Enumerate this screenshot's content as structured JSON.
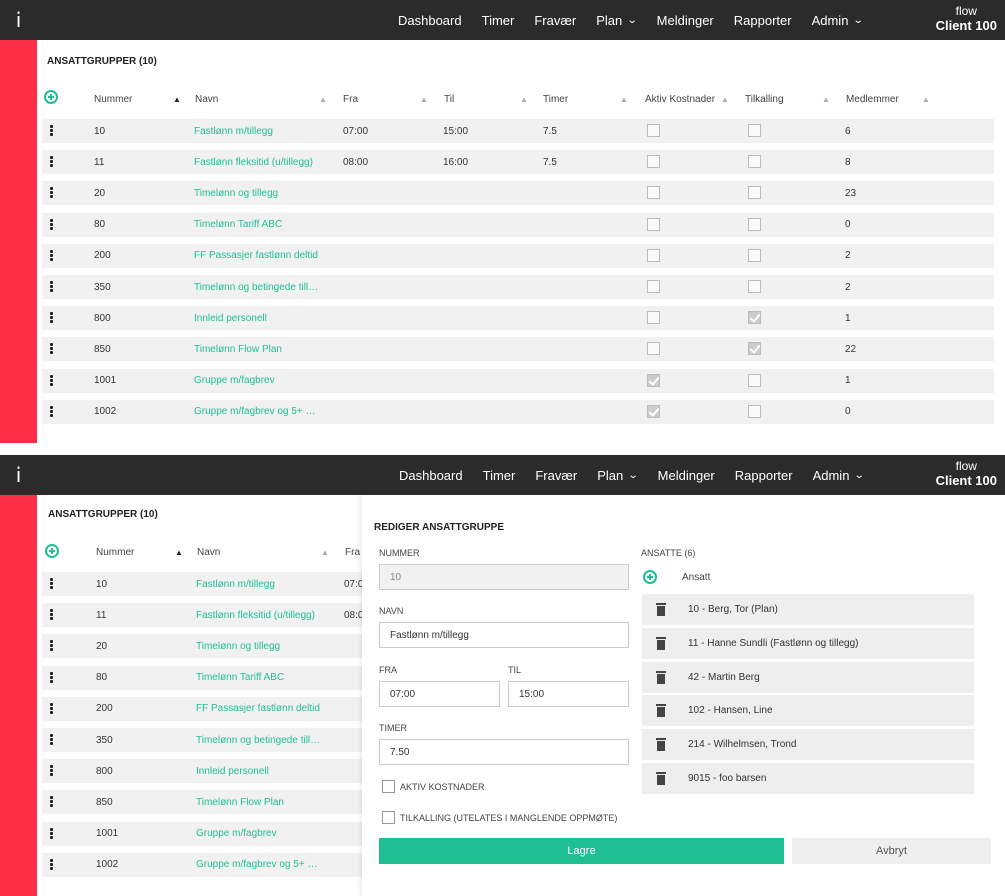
{
  "topbar": {
    "logo": "i",
    "nav": [
      "Dashboard",
      "Timer",
      "Fravær",
      "Plan",
      "Meldinger",
      "Rapporter",
      "Admin"
    ],
    "client_line1": "flow",
    "client_line2": "Client 100"
  },
  "list": {
    "title": "ANSATTGRUPPER (10)",
    "headers": {
      "nummer": "Nummer",
      "navn": "Navn",
      "fra": "Fra",
      "til": "Til",
      "timer": "Timer",
      "aktiv": "Aktiv Kostnader",
      "tilkalling": "Tilkalling",
      "medlemmer": "Medlemmer"
    },
    "rows": [
      {
        "nummer": "10",
        "navn": "Fastlønn m/tillegg",
        "navn_short": "Fastlønn m/tillegg",
        "fra": "07:00",
        "til": "15:00",
        "timer": "7.5",
        "aktiv": false,
        "tilkalling": false,
        "medlemmer": "6"
      },
      {
        "nummer": "11",
        "navn": "Fastlønn fleksitid (u/tillegg)",
        "navn_short": "Fastlønn fleksitid (u/tillegg)",
        "fra": "08:00",
        "til": "16:00",
        "timer": "7.5",
        "aktiv": false,
        "tilkalling": false,
        "medlemmer": "8"
      },
      {
        "nummer": "20",
        "navn": "Timelønn og tillegg",
        "navn_short": "Timelønn og tillegg",
        "fra": "",
        "til": "",
        "timer": "",
        "aktiv": false,
        "tilkalling": false,
        "medlemmer": "23"
      },
      {
        "nummer": "80",
        "navn": "Timelønn Tariff ABC",
        "navn_short": "Timelønn Tariff ABC",
        "fra": "",
        "til": "",
        "timer": "",
        "aktiv": false,
        "tilkalling": false,
        "medlemmer": "0"
      },
      {
        "nummer": "200",
        "navn": "FF Passasjer fastlønn deltid",
        "navn_short": "FF Passasjer fastlønn deltid",
        "fra": "",
        "til": "",
        "timer": "",
        "aktiv": false,
        "tilkalling": false,
        "medlemmer": "2"
      },
      {
        "nummer": "350",
        "navn": "Timelønn og betingede till…",
        "navn_short": "Timelønn og betingede till…",
        "fra": "",
        "til": "",
        "timer": "",
        "aktiv": false,
        "tilkalling": false,
        "medlemmer": "2"
      },
      {
        "nummer": "800",
        "navn": "Innleid personell",
        "navn_short": "Innleid personell",
        "fra": "",
        "til": "",
        "timer": "",
        "aktiv": false,
        "tilkalling": true,
        "medlemmer": "1"
      },
      {
        "nummer": "850",
        "navn": "Timelønn Flow Plan",
        "navn_short": "Timelønn Flow Plan",
        "fra": "",
        "til": "",
        "timer": "",
        "aktiv": false,
        "tilkalling": true,
        "medlemmer": "22"
      },
      {
        "nummer": "1001",
        "navn": "Gruppe m/fagbrev",
        "navn_short": "Gruppe m/fagbrev",
        "fra": "",
        "til": "",
        "timer": "",
        "aktiv": true,
        "tilkalling": false,
        "medlemmer": "1"
      },
      {
        "nummer": "1002",
        "navn": "Gruppe m/fagbrev og 5+ …",
        "navn_short": "Gruppe m/fagbrev og 5+ …",
        "fra": "",
        "til": "",
        "timer": "",
        "aktiv": true,
        "tilkalling": false,
        "medlemmer": "0"
      }
    ],
    "panel2_fra": [
      "07:0",
      "08:0"
    ]
  },
  "edit": {
    "title": "REDIGER ANSATTGRUPPE",
    "nummer_label": "NUMMER",
    "nummer_value": "10",
    "navn_label": "NAVN",
    "navn_value": "Fastlønn m/tillegg",
    "fra_label": "FRA",
    "fra_value": "07:00",
    "til_label": "TIL",
    "til_value": "15:00",
    "timer_label": "TIMER",
    "timer_value": "7.50",
    "aktiv_label": "AKTIV KOSTNADER",
    "tilkalling_label": "TILKALLING (UTELATES I MANGLENDE OPPMØTE)",
    "ansatte_title": "ANSATTE (6)",
    "ansatt_header": "Ansatt",
    "ansatte": [
      "10 - Berg, Tor (Plan)",
      "11 - Hanne Sundli (Fastlønn og tillegg)",
      "42 - Martin Berg",
      "102 - Hansen, Line",
      "214 - Wilhelmsen, Trond",
      "9015 - foo barsen"
    ],
    "save_label": "Lagre",
    "cancel_label": "Avbryt"
  },
  "colors": {
    "accent": "#1fbf94",
    "sidebar": "#ff2d46",
    "topbar": "#2b2b2b",
    "row_bg": "#f1f1f1"
  }
}
